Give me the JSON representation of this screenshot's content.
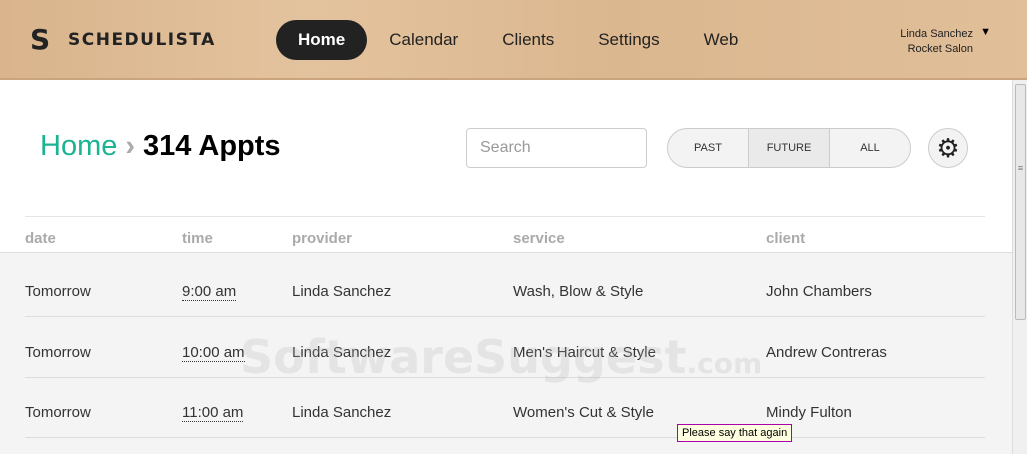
{
  "brand": {
    "name": "SCHEDULISTA"
  },
  "nav": [
    "Home",
    "Calendar",
    "Clients",
    "Settings",
    "Web"
  ],
  "user": {
    "name": "Linda Sanchez",
    "business": "Rocket Salon"
  },
  "breadcrumb": {
    "home": "Home",
    "current": "314 Appts"
  },
  "search": {
    "placeholder": "Search"
  },
  "filters": [
    "PAST",
    "FUTURE",
    "ALL"
  ],
  "columns": [
    "date",
    "time",
    "provider",
    "service",
    "client"
  ],
  "rows": [
    [
      "Tomorrow",
      "9:00 am",
      "Linda Sanchez",
      "Wash, Blow & Style",
      "John Chambers"
    ],
    [
      "Tomorrow",
      "10:00 am",
      "Linda Sanchez",
      "Men's Haircut & Style",
      "Andrew Contreras"
    ],
    [
      "Tomorrow",
      "11:00 am",
      "Linda Sanchez",
      "Women's Cut & Style",
      "Mindy Fulton"
    ]
  ],
  "watermark": {
    "text": "SoftwareSuggest",
    "suffix": ".com"
  },
  "tooltip": "Please say that again"
}
